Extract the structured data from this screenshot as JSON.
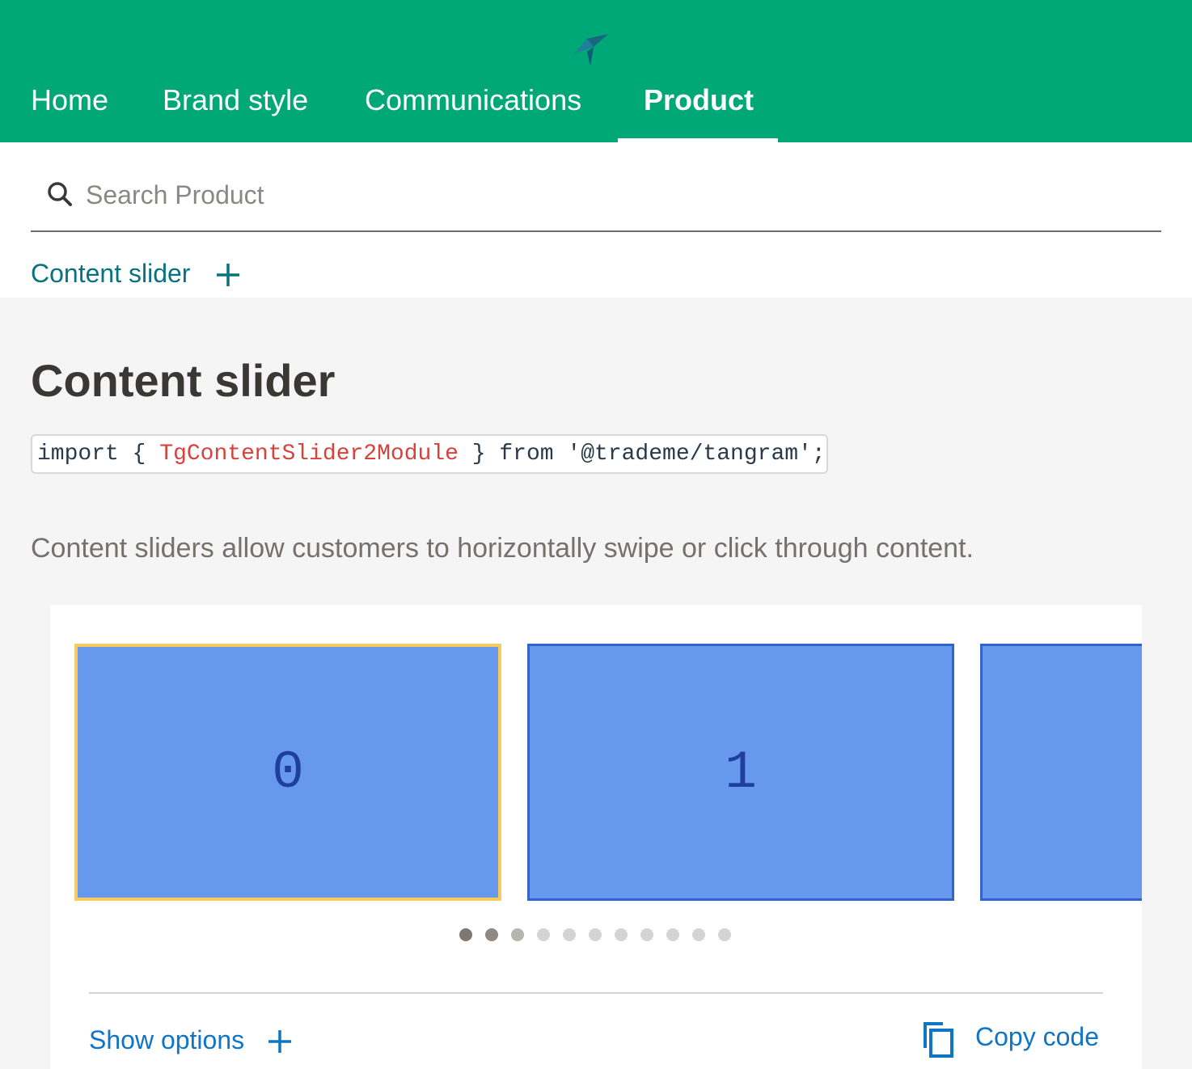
{
  "nav": {
    "items": [
      {
        "label": "Home",
        "active": false
      },
      {
        "label": "Brand style",
        "active": false
      },
      {
        "label": "Communications",
        "active": false
      },
      {
        "label": "Product",
        "active": true
      }
    ]
  },
  "search": {
    "placeholder": "Search Product",
    "value": ""
  },
  "breadcrumb": {
    "label": "Content slider"
  },
  "page": {
    "title": "Content slider",
    "code": {
      "keyword": "import",
      "open": "{",
      "module": "TgContentSlider2Module",
      "close": "}",
      "from": "from",
      "source": "'@trademe/tangram'",
      "semicolon": ";"
    },
    "description": "Content sliders allow customers to horizontally swipe or click through content."
  },
  "demo": {
    "slides": [
      "0",
      "1",
      ""
    ],
    "pagination": {
      "total": 11,
      "active_index": 0
    },
    "show_options_label": "Show options",
    "copy_code_label": "Copy code"
  },
  "colors": {
    "brand": "#00a877",
    "link": "#0f75c4",
    "breadcrumb": "#087380",
    "slide_fill": "#6699ee",
    "slide_border": "#3264cc",
    "focus": "#f6cd5c"
  }
}
